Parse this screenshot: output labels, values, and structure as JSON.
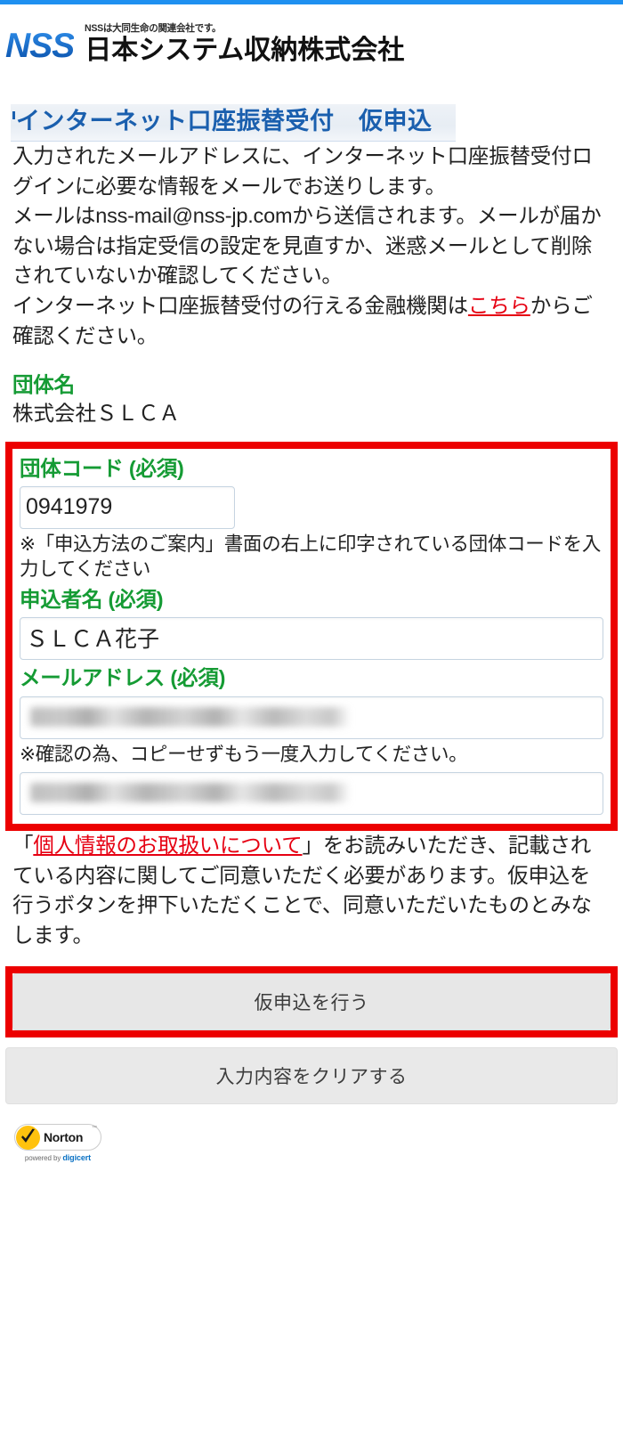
{
  "top_accent_color": "#1e90f0",
  "brand": {
    "logo_mark": "NSS",
    "tagline": "NSSは大同生命の関連会社です。",
    "company_name": "日本システム収納株式会社"
  },
  "page_title": "インターネット口座振替受付　仮申込",
  "intro": {
    "paragraph_1": "入力されたメールアドレスに、インターネット口座振替受付ログインに必要な情報をメールでお送りします。\nメールはnss-mail@nss-jp.comから送信されます。メールが届かない場合は指定受信の設定を見直すか、迷惑メールとして削除されていないか確認してください。",
    "link_sentence_prefix": "インターネット口座振替受付の行える金融機関は",
    "link_text": "こちら",
    "link_sentence_suffix": "からご確認ください。"
  },
  "group_name": {
    "label": "団体名",
    "value": "株式会社ＳＬＣＡ"
  },
  "form": {
    "group_code": {
      "label": "団体コード (必須)",
      "value": "0941979",
      "hint": "※「申込方法のご案内」書面の右上に印字されている団体コードを入力してください"
    },
    "applicant_name": {
      "label": "申込者名 (必須)",
      "value": "ＳＬＣＡ花子"
    },
    "email": {
      "label": "メールアドレス (必須)",
      "value": "",
      "placeholder": "",
      "confirm_hint": "※確認の為、コピーせずもう一度入力してください。",
      "confirm_value": "",
      "confirm_placeholder": ""
    }
  },
  "consent": {
    "quote_open": "「",
    "link_text": "個人情報のお取扱いについて",
    "quote_close": "」",
    "rest": "をお読みいただき、記載されている内容に関してご同意いただく必要があります。仮申込を行うボタンを押下いただくことで、同意いただいたものとみなします。"
  },
  "actions": {
    "submit_label": "仮申込を行う",
    "clear_label": "入力内容をクリアする"
  },
  "seal": {
    "name": "Norton",
    "powered_prefix": "powered by ",
    "powered_brand": "digicert"
  },
  "colors": {
    "green_label": "#159b34",
    "red_link": "#e60012",
    "red_highlight": "#ec0000",
    "title_blue": "#1a5fae",
    "logo_blue": "#0a63c8"
  }
}
